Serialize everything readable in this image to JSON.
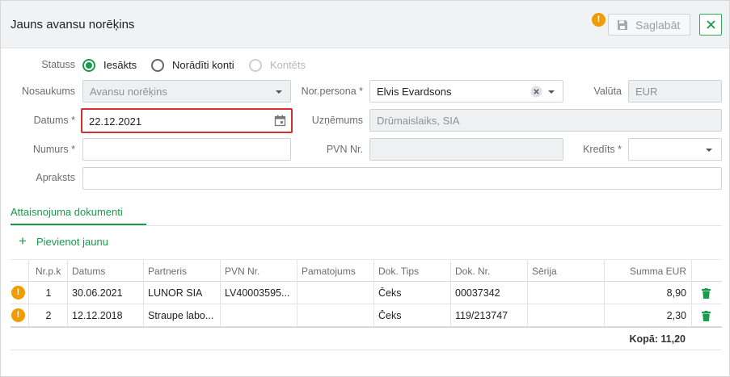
{
  "dialog": {
    "title": "Jauns avansu norēķins",
    "save_label": "Saglabāt",
    "warning_glyph": "!"
  },
  "form": {
    "status": {
      "label": "Statuss",
      "options": [
        {
          "label": "Iesākts",
          "selected": true,
          "disabled": false
        },
        {
          "label": "Norādīti konti",
          "selected": false,
          "disabled": false
        },
        {
          "label": "Kontēts",
          "selected": false,
          "disabled": true
        }
      ]
    },
    "nosaukums": {
      "label": "Nosaukums",
      "value": "Avansu norēķins"
    },
    "nor_persona": {
      "label": "Nor.persona *",
      "value": "Elvis Evardsons"
    },
    "valuta": {
      "label": "Valūta",
      "value": "EUR"
    },
    "datums": {
      "label": "Datums *",
      "value": "22.12.2021"
    },
    "uznemums": {
      "label": "Uzņēmums",
      "value": "Drūmaislaiks, SIA"
    },
    "numurs": {
      "label": "Numurs *",
      "value": ""
    },
    "pvn_nr": {
      "label": "PVN Nr.",
      "value": ""
    },
    "kredits": {
      "label": "Kredīts *",
      "value": ""
    },
    "apraksts": {
      "label": "Apraksts",
      "value": ""
    }
  },
  "tabs": {
    "active": "Attaisnojuma dokumenti"
  },
  "add_new_label": "Pievienot jaunu",
  "grid": {
    "columns": [
      "Nr.p.k",
      "Datums",
      "Partneris",
      "PVN Nr.",
      "Pamatojums",
      "Dok. Tips",
      "Dok. Nr.",
      "Sērija",
      "Summa EUR"
    ],
    "rows": [
      {
        "nr": "1",
        "datums": "30.06.2021",
        "partneris": "LUNOR SIA",
        "pvn": "LV40003595...",
        "pamatojums": "",
        "tips": "Čeks",
        "dok_nr": "00037342",
        "serija": "",
        "summa": "8,90"
      },
      {
        "nr": "2",
        "datums": "12.12.2018",
        "partneris": "Straupe labo...",
        "pvn": "",
        "pamatojums": "",
        "tips": "Čeks",
        "dok_nr": "119/213747",
        "serija": "",
        "summa": "2,30"
      }
    ],
    "total": "Kopā: 11,20"
  },
  "colors": {
    "accent": "#1a9a4a",
    "warning": "#f09c00",
    "focus_border": "#d32f2f"
  }
}
